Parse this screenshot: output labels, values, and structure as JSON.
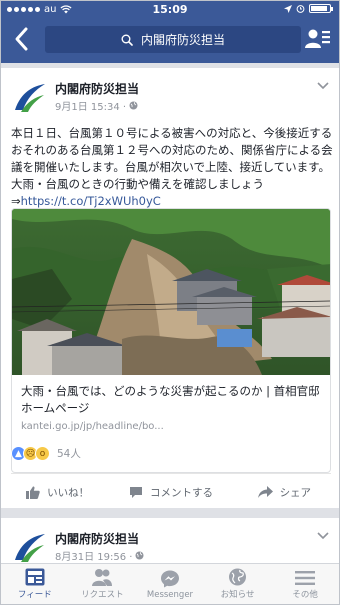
{
  "status": {
    "carrier": "au",
    "time": "15:09"
  },
  "nav": {
    "search_text": "内閣府防災担当"
  },
  "post": {
    "page_name": "内閣府防災担当",
    "timestamp": "9月1日 15:34 ·",
    "body_line1": "本日１日、台風第１０号による被害への対応と、今後接近するおそれのある台風第１２号への対応のため、関係省庁による会議を開催いたします。台風が相次いで上陸、接近しています。大雨・台風のときの行動や備えを確認しましょう⇒",
    "body_link": "https://t.co/Tj2xWUh0yC",
    "link_title": "大雨・台風では、どのような災害が起こるのか | 首相官邸ホームページ",
    "link_domain": "kantei.go.jp/jp/headline/bo...",
    "reaction_count": "54人",
    "actions": {
      "like": "いいね！",
      "comment": "コメントする",
      "share": "シェア"
    }
  },
  "post2": {
    "page_name": "内閣府防災担当",
    "timestamp": "8月31日 19:56 ·"
  },
  "tabs": [
    {
      "label": "フィード",
      "icon": "feed-icon"
    },
    {
      "label": "リクエスト",
      "icon": "friend-requests-icon"
    },
    {
      "label": "Messenger",
      "icon": "messenger-icon"
    },
    {
      "label": "お知らせ",
      "icon": "globe-icon"
    },
    {
      "label": "その他",
      "icon": "menu-icon"
    }
  ],
  "colors": {
    "brand": "#3b5998",
    "link": "#365899",
    "muted": "#90949c"
  }
}
